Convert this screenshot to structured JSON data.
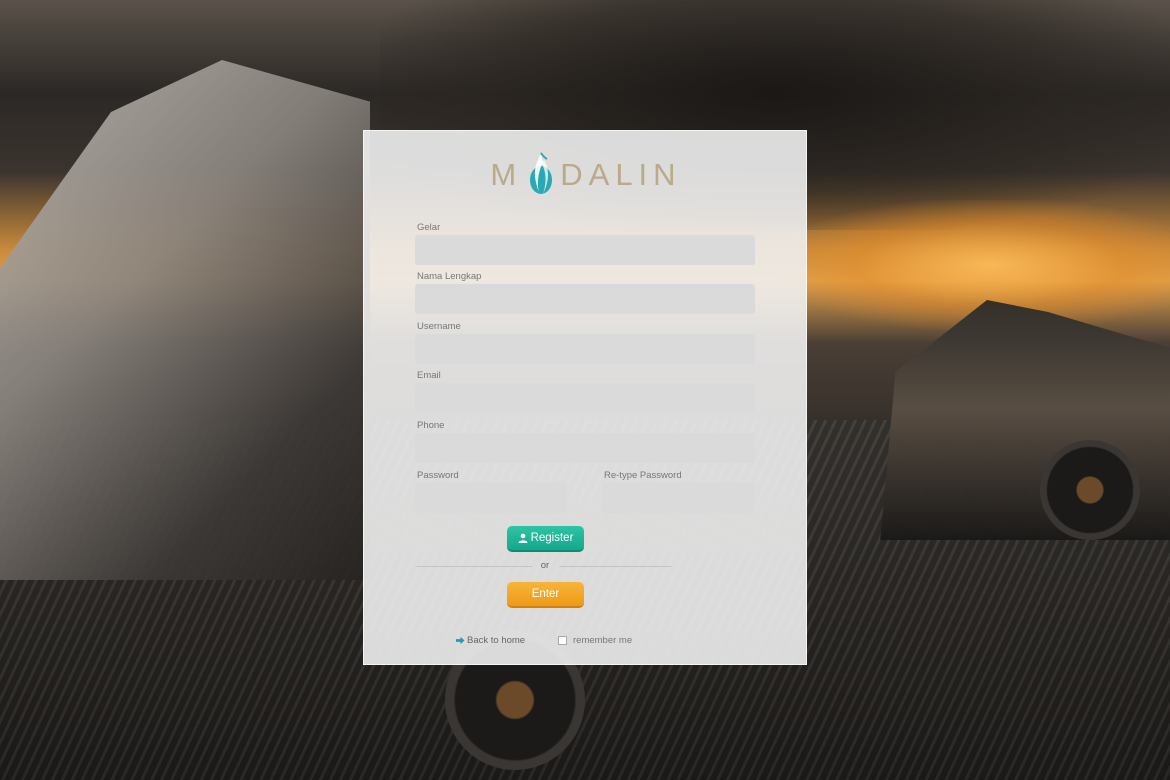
{
  "brand": {
    "logo_text_left": "M",
    "logo_text_right": "DALIN",
    "accent": "#1aa7a0",
    "logo_color": "#bba98b"
  },
  "form": {
    "gelar_label": "Gelar",
    "nama_label": "Nama Lengkap",
    "username_label": "Username",
    "email_label": "Email",
    "phone_label": "Phone",
    "password_label": "Password",
    "retype_label": "Re-type Password",
    "gelar_value": "",
    "nama_value": "",
    "username_value": "",
    "email_value": "",
    "phone_value": "",
    "password_value": "",
    "retype_value": ""
  },
  "buttons": {
    "register_label": "Register",
    "or_label": "or",
    "enter_label": "Enter",
    "register_color": "#1ab394",
    "enter_color": "#f0a020"
  },
  "footer": {
    "back_label": "Back to home",
    "remember_label": "remember me",
    "back_icon": "arrow-right-icon"
  }
}
